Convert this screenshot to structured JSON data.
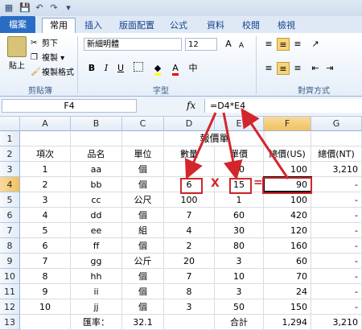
{
  "quick_access": {
    "save": "💾",
    "undo": "↶",
    "redo": "↷"
  },
  "tabs": {
    "file": "檔案",
    "home": "常用",
    "insert": "插入",
    "layout": "版面配置",
    "formulas": "公式",
    "data": "資料",
    "review": "校閱",
    "view": "檢視"
  },
  "ribbon": {
    "paste": "貼上",
    "cut": "剪下",
    "copy": "複製 ▾",
    "format_painter": "複製格式",
    "clipboard": "剪貼簿",
    "font_group": "字型",
    "align_group": "對齊方式",
    "font_name": "新細明體",
    "font_size": "12",
    "bold": "B",
    "italic": "I",
    "underline": "U",
    "grow": "A",
    "shrink": "A",
    "fontcolor": "A",
    "fill": "▾"
  },
  "formula_bar": {
    "namebox": "F4",
    "fx": "fx",
    "formula": "=D4*E4"
  },
  "columns": [
    "A",
    "B",
    "C",
    "D",
    "E",
    "F",
    "G"
  ],
  "rows": [
    {
      "n": "1",
      "cells": [
        "",
        "",
        "",
        "報價單",
        "",
        "",
        ""
      ]
    },
    {
      "n": "2",
      "cells": [
        "項次",
        "品名",
        "單位",
        "數量",
        "單價",
        "總價(US)",
        "總價(NT)"
      ]
    },
    {
      "n": "3",
      "cells": [
        "1",
        "aa",
        "個",
        "5",
        "20",
        "100",
        "3,210"
      ]
    },
    {
      "n": "4",
      "cells": [
        "2",
        "bb",
        "個",
        "6",
        "15",
        "90",
        "-"
      ]
    },
    {
      "n": "5",
      "cells": [
        "3",
        "cc",
        "公尺",
        "100",
        "1",
        "100",
        "-"
      ]
    },
    {
      "n": "6",
      "cells": [
        "4",
        "dd",
        "個",
        "7",
        "60",
        "420",
        "-"
      ]
    },
    {
      "n": "7",
      "cells": [
        "5",
        "ee",
        "組",
        "4",
        "30",
        "120",
        "-"
      ]
    },
    {
      "n": "8",
      "cells": [
        "6",
        "ff",
        "個",
        "2",
        "80",
        "160",
        "-"
      ]
    },
    {
      "n": "9",
      "cells": [
        "7",
        "gg",
        "公斤",
        "20",
        "3",
        "60",
        "-"
      ]
    },
    {
      "n": "10",
      "cells": [
        "8",
        "hh",
        "個",
        "7",
        "10",
        "70",
        "-"
      ]
    },
    {
      "n": "11",
      "cells": [
        "9",
        "ii",
        "個",
        "8",
        "3",
        "24",
        "-"
      ]
    },
    {
      "n": "12",
      "cells": [
        "10",
        "jj",
        "個",
        "3",
        "50",
        "150",
        "-"
      ]
    },
    {
      "n": "13",
      "cells": [
        "",
        "匯率：",
        "32.1",
        "",
        "合計",
        "1,294",
        "3,210"
      ]
    }
  ],
  "annotations": {
    "times": "X",
    "equals": "="
  },
  "colors": {
    "accent": "#d2262c",
    "selection": "#f1c15e",
    "file_tab": "#2a6cc4"
  }
}
